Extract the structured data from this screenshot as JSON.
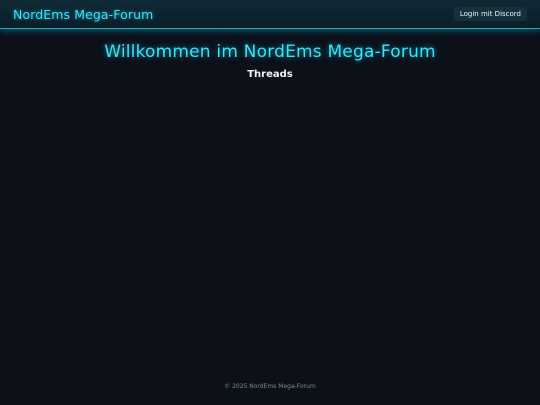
{
  "header": {
    "brand": "NordEms Mega-Forum",
    "login_label": "Login mit Discord"
  },
  "main": {
    "welcome_title": "Willkommen im NordEms Mega-Forum",
    "threads_heading": "Threads",
    "threads": []
  },
  "footer": {
    "copyright": "© 2025 NordEms Mega-Forum"
  },
  "colors": {
    "background": "#0b1019",
    "accent": "#2ee9ff",
    "header_bg": "#0f2a35",
    "button_bg": "#17313c"
  }
}
